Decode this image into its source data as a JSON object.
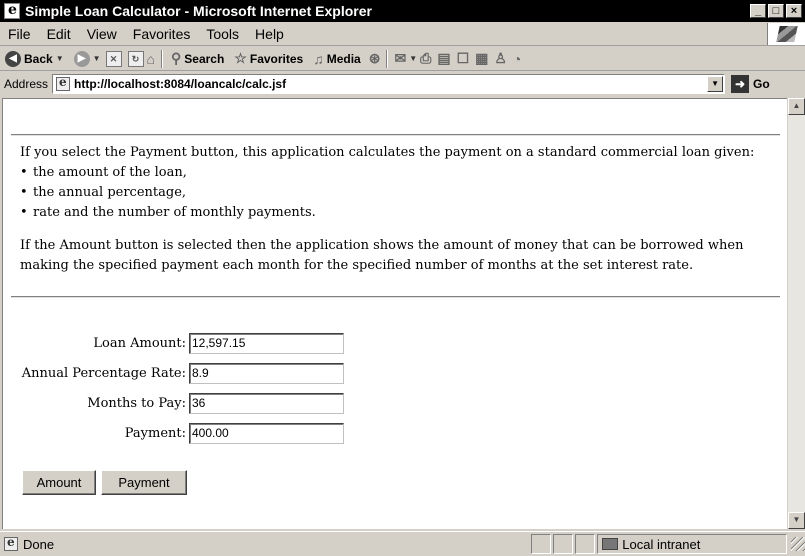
{
  "window": {
    "title": "Simple Loan Calculator - Microsoft Internet Explorer",
    "controls": [
      "_",
      "□",
      "×"
    ]
  },
  "menu": [
    "File",
    "Edit",
    "View",
    "Favorites",
    "Tools",
    "Help"
  ],
  "toolbar": {
    "back_label": "Back",
    "search_label": "Search",
    "favorites_label": "Favorites",
    "media_label": "Media"
  },
  "address": {
    "label": "Address",
    "url": "http://localhost:8084/loancalc/calc.jsf",
    "go_label": "Go"
  },
  "page": {
    "intro": "If you select the Payment button, this application calculates the payment on a standard commercial loan given:",
    "bullets": [
      "the amount of the loan,",
      "the annual percentage,",
      "rate and the number of monthly payments."
    ],
    "para2_line1": "If the Amount button is selected then the application shows the amount of money that can be borrowed when",
    "para2_line2": "making the specified payment each month for the specified number of months at the set interest rate."
  },
  "form": {
    "loan_amount_label": "Loan Amount:",
    "loan_amount_value": "12,597.15",
    "apr_label": "Annual Percentage Rate:",
    "apr_value": "8.9",
    "months_label": "Months to Pay:",
    "months_value": "36",
    "payment_label": "Payment:",
    "payment_value": "400.00",
    "amount_button": "Amount",
    "payment_button": "Payment"
  },
  "status": {
    "text": "Done",
    "zone": "Local intranet"
  }
}
